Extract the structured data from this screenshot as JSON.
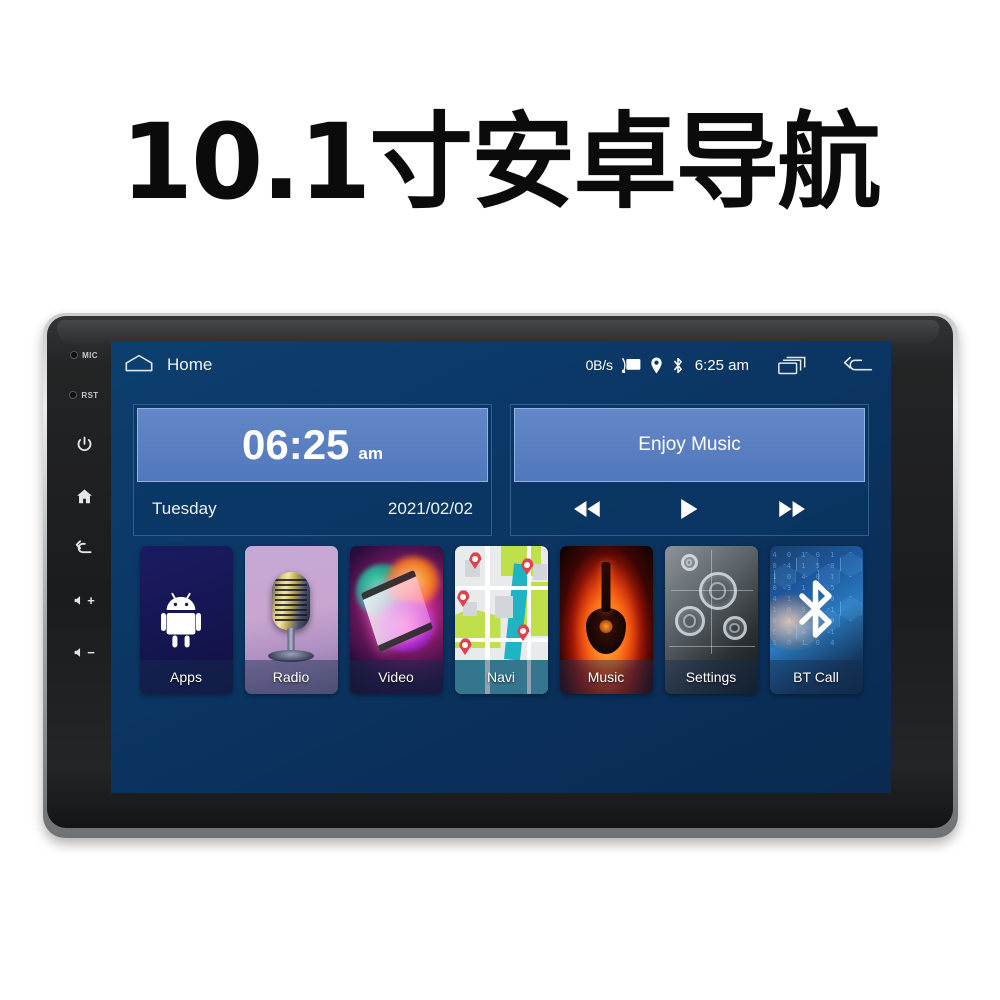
{
  "page": {
    "title": "10.1寸安卓导航"
  },
  "device": {
    "name": "android-car-head-unit",
    "hardware_buttons": [
      {
        "id": "mic",
        "label": "MIC",
        "type": "hole"
      },
      {
        "id": "rst",
        "label": "RST",
        "type": "hole"
      },
      {
        "id": "power",
        "label": "Power",
        "icon": "power-icon"
      },
      {
        "id": "home",
        "label": "Home",
        "icon": "home-icon"
      },
      {
        "id": "back",
        "label": "Back",
        "icon": "back-arrow-icon"
      },
      {
        "id": "volume-up",
        "label": "Volume Up",
        "icon": "volume-up-icon",
        "sign": "+"
      },
      {
        "id": "volume-down",
        "label": "Volume Down",
        "icon": "volume-down-icon",
        "sign": "−"
      }
    ]
  },
  "statusbar": {
    "home_label": "Home",
    "home_icon": "home-outline-icon",
    "net_speed": "0B/s",
    "cast_icon": "cast-icon",
    "location_icon": "location-pin-icon",
    "bluetooth_icon": "bluetooth-icon",
    "clock": "6:25 am",
    "recents_icon": "recents-icon",
    "back_icon": "back-arrow-icon"
  },
  "widgets": {
    "clock": {
      "time": "06:25",
      "ampm": "am",
      "weekday": "Tuesday",
      "date": "2021/02/02"
    },
    "music": {
      "title": "Enjoy Music",
      "controls": [
        {
          "id": "prev",
          "label": "Previous",
          "icon": "rewind-icon"
        },
        {
          "id": "play",
          "label": "Play",
          "icon": "play-icon"
        },
        {
          "id": "next",
          "label": "Next",
          "icon": "fast-forward-icon"
        }
      ]
    }
  },
  "dock": {
    "apps": [
      {
        "id": "apps",
        "label": "Apps",
        "art": "android-robot"
      },
      {
        "id": "radio",
        "label": "Radio",
        "art": "retro-microphone"
      },
      {
        "id": "video",
        "label": "Video",
        "art": "colorful-film-strip"
      },
      {
        "id": "navi",
        "label": "Navi",
        "art": "street-map"
      },
      {
        "id": "music",
        "label": "Music",
        "art": "flaming-guitar"
      },
      {
        "id": "settings",
        "label": "Settings",
        "art": "gears-blueprint"
      },
      {
        "id": "btcall",
        "label": "BT Call",
        "art": "bluetooth-tech"
      }
    ]
  },
  "colors": {
    "screen_bg": "#0b3765",
    "widget_panel": "#5a7fc1",
    "widget_border": "#93b2de",
    "text_primary": "#ffffff",
    "bezel": "#1e1f20",
    "rim": "#c9ccce",
    "title_text": "#0b0b0b"
  }
}
